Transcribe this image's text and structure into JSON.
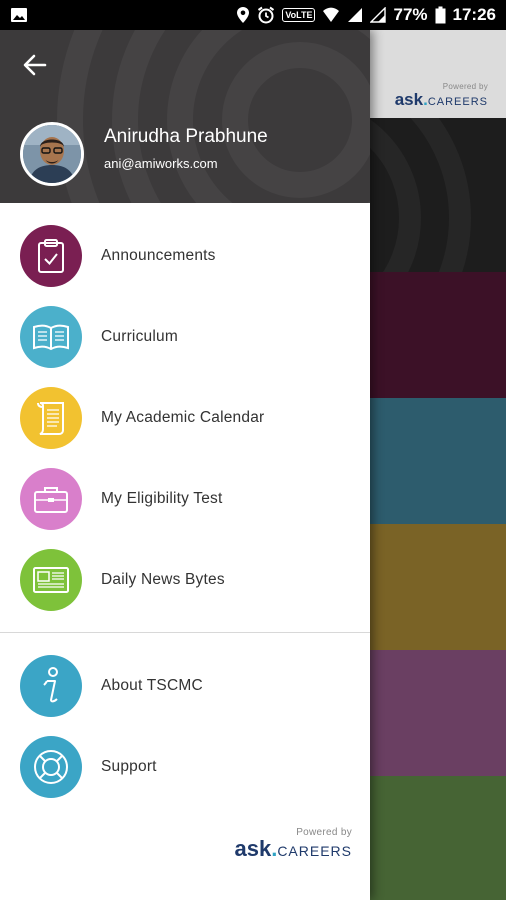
{
  "status_bar": {
    "volte_label": "VoLTE",
    "battery_percent": "77%",
    "time": "17:26"
  },
  "background_app": {
    "brand": {
      "powered_by": "Powered by",
      "name_ask": "ask",
      "name_careers": "CAREERS"
    },
    "band_colors": [
      "#3c1127",
      "#2d5c6d",
      "#7a6326",
      "#6a3f62",
      "#466434"
    ]
  },
  "drawer": {
    "back_label": "back",
    "user": {
      "name": "Anirudha Prabhune",
      "email": "ani@amiworks.com"
    },
    "menu_items": [
      {
        "label": "Announcements",
        "icon": "clipboard-check-icon",
        "color": "#7a1f52"
      },
      {
        "label": "Curriculum",
        "icon": "open-book-icon",
        "color": "#4bb0cb"
      },
      {
        "label": "My Academic Calendar",
        "icon": "scroll-icon",
        "color": "#f2c230"
      },
      {
        "label": "My Eligibility Test",
        "icon": "briefcase-icon",
        "color": "#d97fcb"
      },
      {
        "label": "Daily News Bytes",
        "icon": "newspaper-icon",
        "color": "#7ec23a"
      }
    ],
    "secondary_items": [
      {
        "label": "About TSCMC",
        "icon": "info-icon",
        "color": "#3ba5c6"
      },
      {
        "label": "Support",
        "icon": "lifebuoy-icon",
        "color": "#3ba5c6"
      }
    ],
    "brand": {
      "powered_by": "Powered by",
      "name_ask": "ask",
      "name_careers": "CAREERS"
    }
  }
}
